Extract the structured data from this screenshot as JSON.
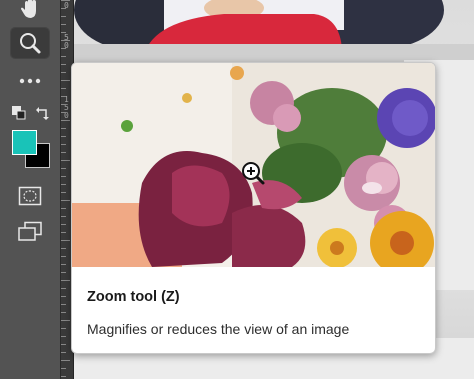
{
  "toolbar": {
    "tools": [
      {
        "name": "hand-tool-button",
        "icon": "hand-icon",
        "active": false
      },
      {
        "name": "zoom-tool-button",
        "icon": "magnifier-icon",
        "active": true
      },
      {
        "name": "more-tools-button",
        "icon": "ellipsis-icon",
        "active": false
      },
      {
        "name": "quick-mask-button",
        "icon": "quick-mask-icon",
        "active": false
      },
      {
        "name": "screen-mode-button",
        "icon": "screen-mode-icon",
        "active": false
      }
    ],
    "foreground_color": "#19c3b8",
    "background_color": "#000000"
  },
  "ruler": {
    "labels": [
      "0",
      "5",
      "0",
      "1",
      "5",
      "0"
    ]
  },
  "tooltip": {
    "title": "Zoom tool (Z)",
    "description": "Magnifies or reduces the view of an image"
  },
  "colors": {
    "toolbar_bg": "#535353",
    "accent_red": "#d8283c",
    "tooltip_bg": "#ffffff"
  }
}
